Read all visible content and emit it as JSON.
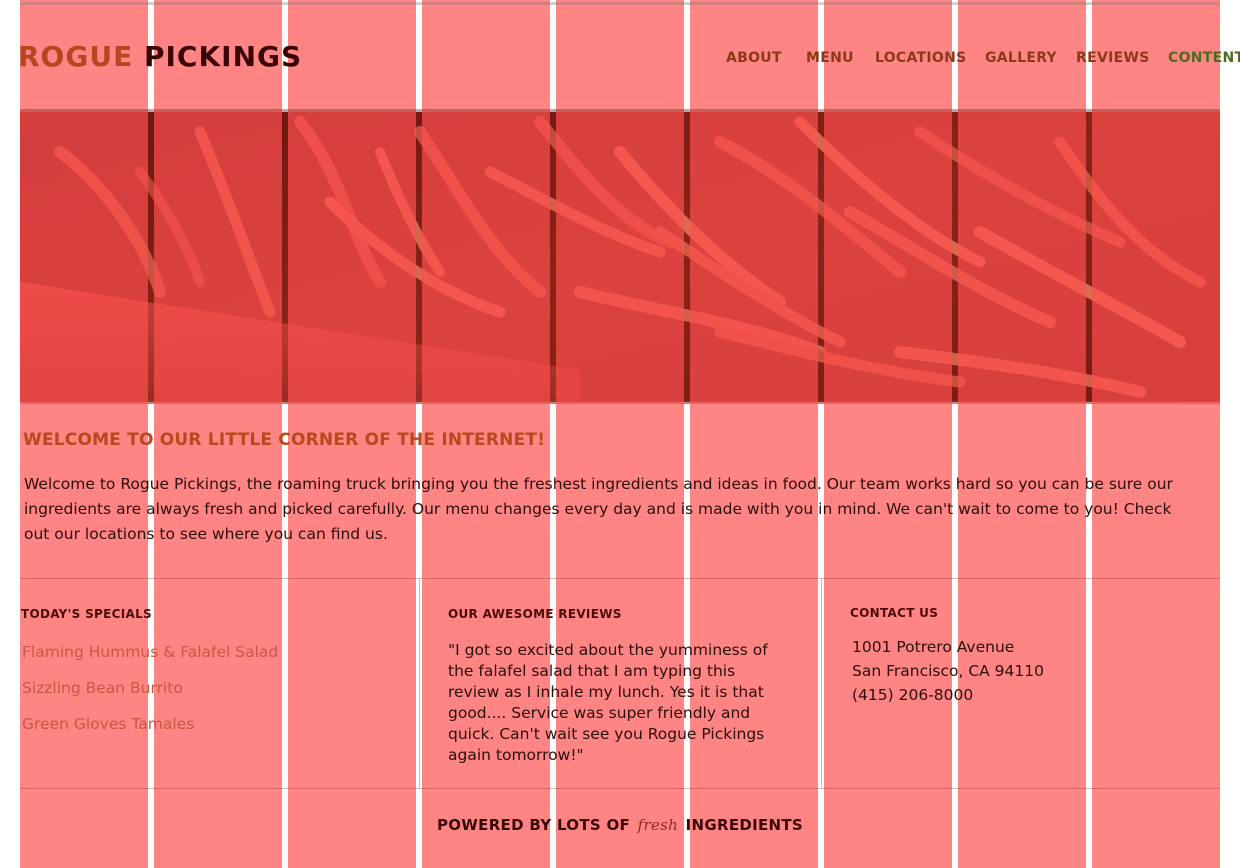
{
  "header": {
    "logo_part1": "ROGUE",
    "logo_part2": "PICKINGS",
    "nav": [
      {
        "label": "ABOUT"
      },
      {
        "label": "MENU"
      },
      {
        "label": "LOCATIONS"
      },
      {
        "label": "GALLERY"
      },
      {
        "label": "REVIEWS"
      },
      {
        "label": "CONTENT"
      }
    ]
  },
  "hero": {
    "image": "green-beans-photo"
  },
  "welcome": {
    "title": "WELCOME TO OUR LITTLE CORNER OF THE INTERNET!",
    "body": "Welcome to Rogue Pickings, the roaming truck bringing you the freshest ingredients and ideas in food. Our team works hard so you can be sure our ingredients are always fresh and picked carefully. Our menu changes every day and is made with you in mind. We can't wait to come to you! Check out our locations to see where you can find us."
  },
  "specials": {
    "title": "TODAY'S SPECIALS",
    "items": [
      "Flaming Hummus & Falafel Salad",
      "Sizzling Bean Burrito",
      "Green Gloves Tamales"
    ]
  },
  "reviews": {
    "title": "OUR AWESOME REVIEWS",
    "quote": "\"I got so excited about the yumminess of the falafel salad that I am typing this review as I inhale my lunch. Yes it is that good.... Service was super friendly and quick. Can't wait see you Rogue Pickings again tomorrow!\""
  },
  "contact": {
    "title": "CONTACT US",
    "address1": "1001 Potrero Avenue",
    "address2": "San Francisco, CA 94110",
    "phone": "(415) 206-8000"
  },
  "footer": {
    "before": "POWERED BY LOTS OF",
    "script": "fresh",
    "after": "INGREDIENTS"
  },
  "colors": {
    "overlay": "#ff5050",
    "accent_orange": "#b8451f",
    "dark_maroon": "#3b0606",
    "nav_green": "#4f6a1f"
  }
}
